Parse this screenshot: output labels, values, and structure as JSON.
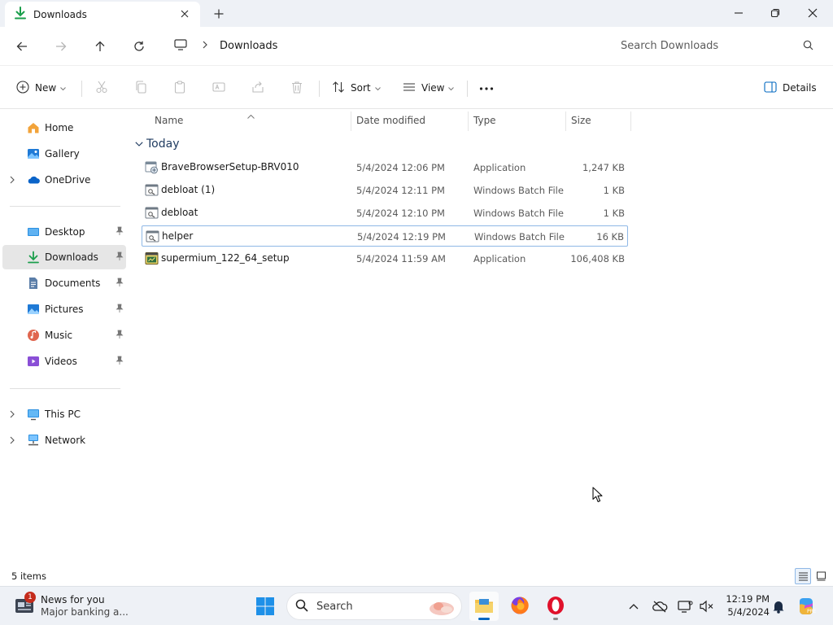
{
  "window": {
    "tab_title": "Downloads"
  },
  "address": {
    "crumb": "Downloads",
    "search_placeholder": "Search Downloads"
  },
  "commands": {
    "new": "New",
    "sort": "Sort",
    "view": "View",
    "details": "Details"
  },
  "sidebar": {
    "items": [
      {
        "label": "Home",
        "icon": "home-icon"
      },
      {
        "label": "Gallery",
        "icon": "gallery-icon"
      },
      {
        "label": "OneDrive",
        "icon": "onedrive-icon"
      },
      {
        "label": "Desktop",
        "icon": "desktop-icon"
      },
      {
        "label": "Downloads",
        "icon": "download-icon"
      },
      {
        "label": "Documents",
        "icon": "documents-icon"
      },
      {
        "label": "Pictures",
        "icon": "pictures-icon"
      },
      {
        "label": "Music",
        "icon": "music-icon"
      },
      {
        "label": "Videos",
        "icon": "videos-icon"
      },
      {
        "label": "This PC",
        "icon": "this-pc-icon"
      },
      {
        "label": "Network",
        "icon": "network-icon"
      }
    ]
  },
  "columns": {
    "name": "Name",
    "date": "Date modified",
    "type": "Type",
    "size": "Size"
  },
  "group": {
    "label": "Today"
  },
  "files": [
    {
      "name": "BraveBrowserSetup-BRV010",
      "date": "5/4/2024 12:06 PM",
      "type": "Application",
      "size": "1,247 KB",
      "icon": "installer-icon"
    },
    {
      "name": "debloat (1)",
      "date": "5/4/2024 12:11 PM",
      "type": "Windows Batch File",
      "size": "1 KB",
      "icon": "batch-file-icon"
    },
    {
      "name": "debloat",
      "date": "5/4/2024 12:10 PM",
      "type": "Windows Batch File",
      "size": "1 KB",
      "icon": "batch-file-icon"
    },
    {
      "name": "helper",
      "date": "5/4/2024 12:19 PM",
      "type": "Windows Batch File",
      "size": "16 KB",
      "icon": "batch-file-icon"
    },
    {
      "name": "supermium_122_64_setup",
      "date": "5/4/2024 11:59 AM",
      "type": "Application",
      "size": "106,408 KB",
      "icon": "application-icon"
    }
  ],
  "status": {
    "count": "5 items"
  },
  "taskbar": {
    "news_title": "News for you",
    "news_subtitle": "Major banking a...",
    "news_badge": "1",
    "search_label": "Search",
    "time": "12:19 PM",
    "date": "5/4/2024"
  },
  "colors": {
    "accent": "#0067c0",
    "download_green": "#1a9e4b",
    "folder_yellow": "#f2c14b"
  }
}
